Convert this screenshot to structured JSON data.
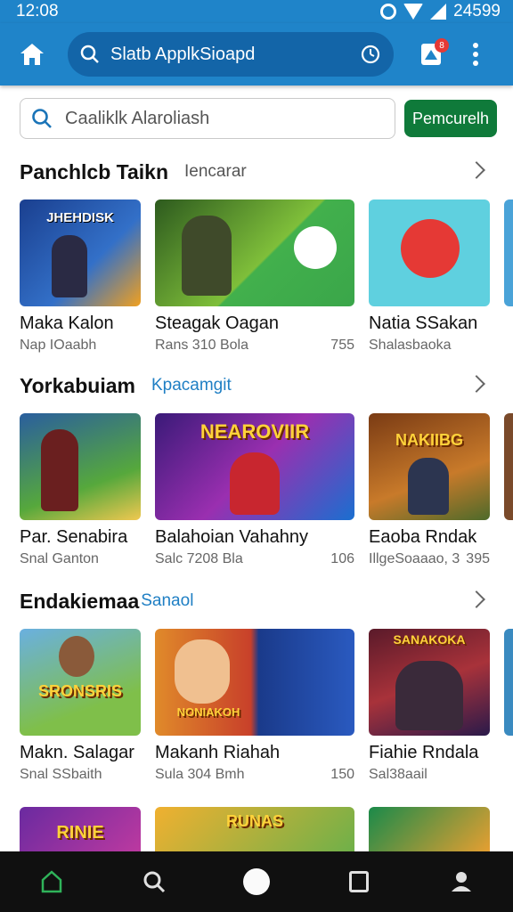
{
  "status": {
    "time": "12:08",
    "right": "24599"
  },
  "appbar": {
    "search_label": "Slatb ApplkSioapd",
    "badge": "8"
  },
  "search": {
    "placeholder": "Caaliklk Alaroliash",
    "button": "Pemcurelh"
  },
  "colors": {
    "primary": "#1f84c9",
    "action": "#0f7a3a",
    "nav_bg": "#101010"
  },
  "sections": [
    {
      "title": "Panchlcb Taikn",
      "subtitle": "Iencarar",
      "cards": [
        {
          "title": "Maka Kalon",
          "meta": "Nap IOaabh",
          "extra": "",
          "thumb_text": "JHEHDISK",
          "tag": "",
          "tag2": ""
        },
        {
          "title": "Steagak Oagan",
          "meta": "Rans 310 Bola",
          "extra": "755",
          "thumb_text": "",
          "tag": "",
          "tag2": ""
        },
        {
          "title": "Natia SSakan",
          "meta": "Shalasbaoka",
          "extra": "",
          "thumb_text": "",
          "tag": "",
          "tag2": ""
        }
      ]
    },
    {
      "title": "Yorkabuiam",
      "subtitle": "Kpacamgit",
      "cards": [
        {
          "title": "Par. Senabira",
          "meta": "Snal Ganton",
          "extra": "",
          "thumb_text": "",
          "tag": "",
          "tag2": ""
        },
        {
          "title": "Balahoian Vahahny",
          "meta": "Salc 7208 Bla",
          "extra": "106",
          "thumb_text": "NEAROVIIR",
          "tag": "",
          "tag2": ""
        },
        {
          "title": "Eaoba Rndak",
          "meta": "IllgeSoaaao, 3",
          "extra": "395",
          "thumb_text": "NAKIIBG",
          "tag": "",
          "tag2": ""
        }
      ]
    },
    {
      "title": "Endakiemaa",
      "subtitle": "Sanaol",
      "cards": [
        {
          "title": "Makn. Salagar",
          "meta": "Snal SSbaith",
          "extra": "",
          "thumb_text": "SRONSRIS",
          "tag": "",
          "tag2": ""
        },
        {
          "title": "Makanh Riahah",
          "meta": "Sula 304 Bmh",
          "extra": "150",
          "thumb_text": "NONIAKOH",
          "tag": "",
          "tag2": ""
        },
        {
          "title": "Fiahie Rndala",
          "meta": "Sal38aail",
          "extra": "",
          "thumb_text": "SANAKOKA",
          "tag": "",
          "tag2": ""
        }
      ]
    }
  ],
  "peek_row": [
    "RINIE",
    "RUNAS",
    ""
  ]
}
